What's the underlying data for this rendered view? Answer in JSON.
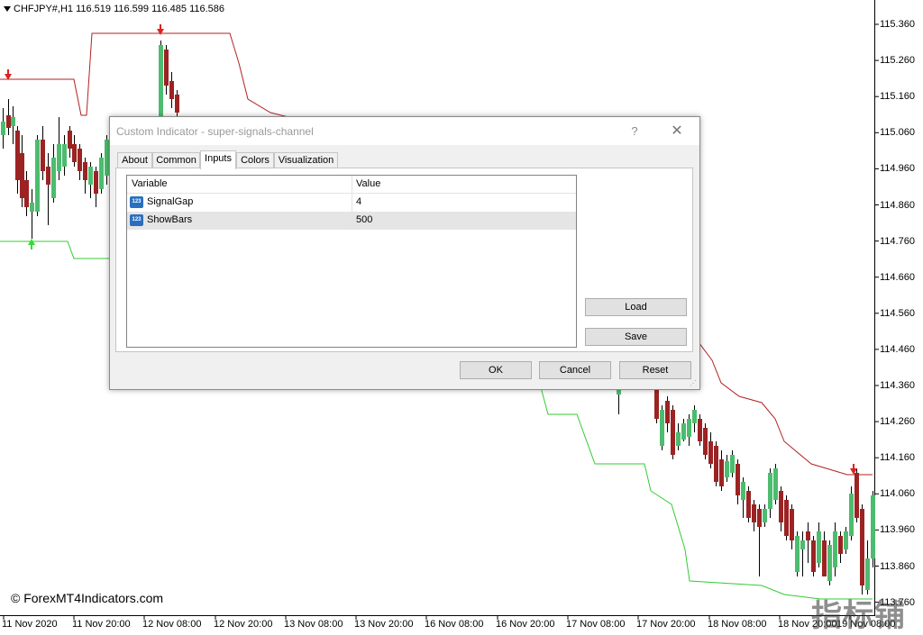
{
  "chart": {
    "symbol_info": "CHFJPY#,H1  116.519 116.599 116.485 116.586",
    "copyright": "© ForexMT4Indicators.com",
    "watermark": "指标铺",
    "colors": {
      "up": "#4cbc6e",
      "down": "#9c2323",
      "upper_channel": "#b22222",
      "lower_channel": "#33cc33",
      "buy_arrow": "#33dd33",
      "sell_arrow": "#dd2222"
    },
    "price_ticks": [
      "115.360",
      "115.260",
      "115.160",
      "115.060",
      "114.960",
      "114.860",
      "114.760",
      "114.660",
      "114.560",
      "114.460",
      "114.360",
      "114.260",
      "114.160",
      "114.060",
      "113.960",
      "113.860",
      "113.760"
    ],
    "time_ticks": [
      "11 Nov 2020",
      "11 Nov 20:00",
      "12 Nov 08:00",
      "12 Nov 20:00",
      "13 Nov 08:00",
      "13 Nov 20:00",
      "16 Nov 08:00",
      "16 Nov 20:00",
      "17 Nov 08:00",
      "17 Nov 20:00",
      "18 Nov 08:00",
      "18 Nov 20:00",
      "19 Nov 08:00"
    ]
  },
  "dialog": {
    "title": "Custom Indicator - super-signals-channel",
    "help_label": "?",
    "close_label": "✕",
    "tabs": [
      {
        "label": "About"
      },
      {
        "label": "Common"
      },
      {
        "label": "Inputs"
      },
      {
        "label": "Colors"
      },
      {
        "label": "Visualization"
      }
    ],
    "active_tab": "Inputs",
    "grid": {
      "col_variable": "Variable",
      "col_value": "Value",
      "icon_text": "123",
      "rows": [
        {
          "name": "SignalGap",
          "value": "4"
        },
        {
          "name": "ShowBars",
          "value": "500"
        }
      ]
    },
    "buttons": {
      "load": "Load",
      "save": "Save",
      "ok": "OK",
      "cancel": "Cancel",
      "reset": "Reset"
    }
  }
}
